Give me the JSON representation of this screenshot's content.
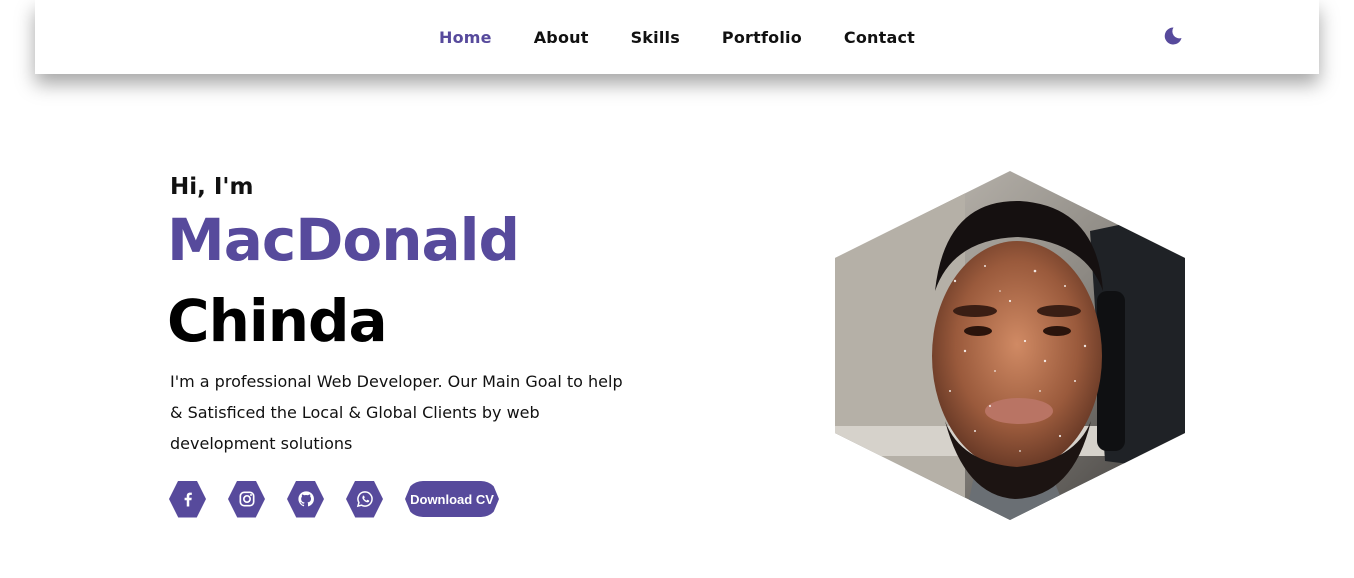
{
  "nav": {
    "items": [
      {
        "label": "Home",
        "active": true
      },
      {
        "label": "About",
        "active": false
      },
      {
        "label": "Skills",
        "active": false
      },
      {
        "label": "Portfolio",
        "active": false
      },
      {
        "label": "Contact",
        "active": false
      }
    ],
    "theme_toggle_icon": "moon-icon"
  },
  "hero": {
    "greeting": "Hi, I'm",
    "first_name": "MacDonald",
    "last_name": "Chinda",
    "bio": "I'm a professional Web Developer. Our Main Goal to help & Satisficed the Local & Global Clients by web development solutions",
    "socials": [
      {
        "icon": "facebook-icon"
      },
      {
        "icon": "instagram-icon"
      },
      {
        "icon": "github-icon"
      },
      {
        "icon": "whatsapp-icon"
      }
    ],
    "cv_button_label": "Download CV"
  },
  "colors": {
    "accent": "#574a9c",
    "text": "#111111",
    "background": "#ffffff"
  }
}
